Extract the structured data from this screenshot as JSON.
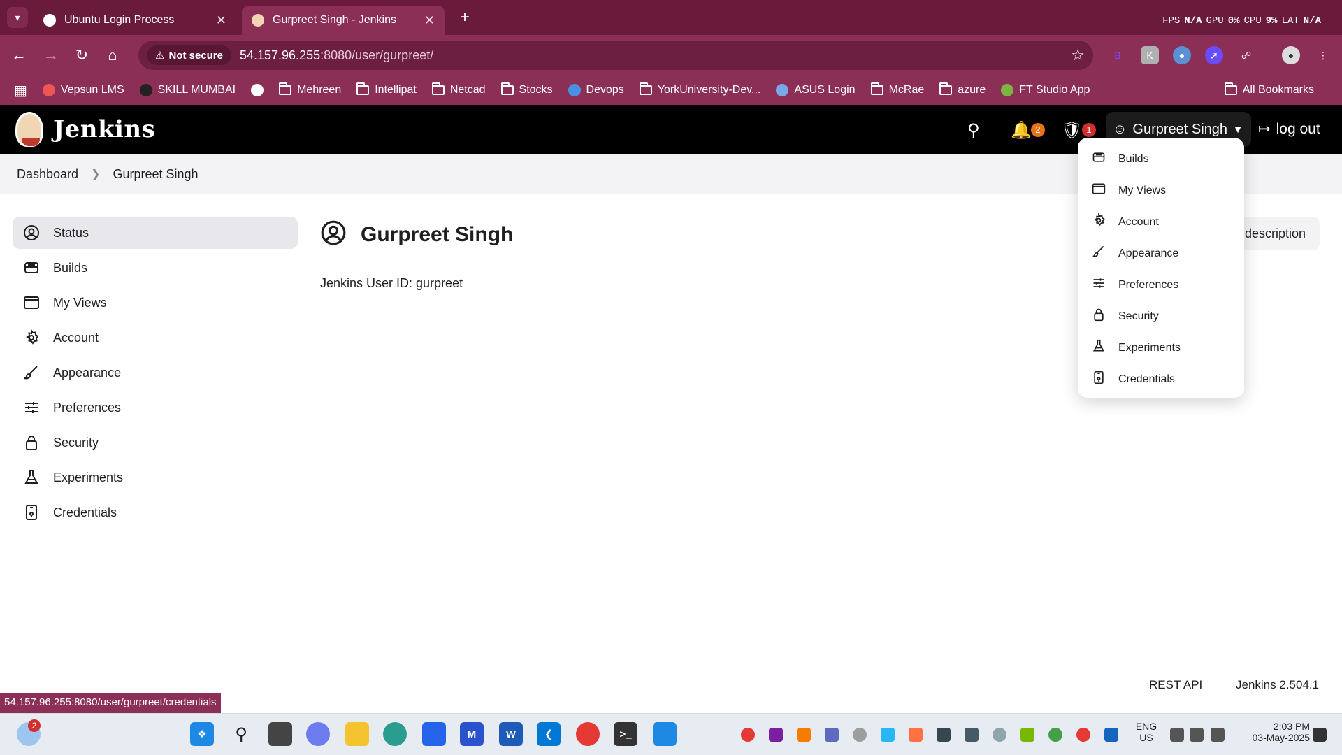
{
  "browser": {
    "tabs": [
      {
        "title": "Ubuntu Login Process",
        "active": false
      },
      {
        "title": "Gurpreet Singh - Jenkins",
        "active": true
      }
    ],
    "perf": {
      "fps_label": "FPS",
      "fps": "N/A",
      "gpu_label": "GPU",
      "gpu": "0%",
      "cpu_label": "CPU",
      "cpu": "9%",
      "lat_label": "LAT",
      "lat": "N/A"
    },
    "security_chip": "Not secure",
    "url_host": "54.157.96.255",
    "url_path": ":8080/user/gurpreet/",
    "bookmarks": [
      "Vepsun LMS",
      "SKILL MUMBAI",
      "Mehreen",
      "Intellipat",
      "Netcad",
      "Stocks",
      "Devops",
      "YorkUniversity-Dev...",
      "ASUS Login",
      "McRae",
      "azure",
      "FT Studio App"
    ],
    "all_bookmarks": "All Bookmarks",
    "status_url": "54.157.96.255:8080/user/gurpreet/credentials"
  },
  "jenkins": {
    "brand": "Jenkins",
    "notifications_count": "2",
    "security_count": "1",
    "user_name": "Gurpreet Singh",
    "logout": "log out",
    "breadcrumb": [
      "Dashboard",
      "Gurpreet Singh"
    ],
    "sidebar": [
      {
        "label": "Status",
        "icon": "user-circle-icon"
      },
      {
        "label": "Builds",
        "icon": "builds-icon"
      },
      {
        "label": "My Views",
        "icon": "window-icon"
      },
      {
        "label": "Account",
        "icon": "gear-icon"
      },
      {
        "label": "Appearance",
        "icon": "brush-icon"
      },
      {
        "label": "Preferences",
        "icon": "sliders-icon"
      },
      {
        "label": "Security",
        "icon": "lock-icon"
      },
      {
        "label": "Experiments",
        "icon": "flask-icon"
      },
      {
        "label": "Credentials",
        "icon": "credentials-icon"
      }
    ],
    "page_title": "Gurpreet Singh",
    "user_id_text": "Jenkins User ID: gurpreet",
    "description_button": "description",
    "dropdown": [
      "Builds",
      "My Views",
      "Account",
      "Appearance",
      "Preferences",
      "Security",
      "Experiments",
      "Credentials"
    ],
    "footer": {
      "rest_api": "REST API",
      "version": "Jenkins 2.504.1"
    }
  },
  "taskbar": {
    "weather_badge": "2",
    "lang_top": "ENG",
    "lang_bottom": "US",
    "time": "2:03 PM",
    "date": "03-May-2025"
  },
  "colors": {
    "chrome_dark": "#6a1b3c",
    "chrome": "#8c2f57",
    "jenkins_header": "#000000",
    "badge_orange": "#e8741a",
    "badge_red": "#d32f2f"
  }
}
